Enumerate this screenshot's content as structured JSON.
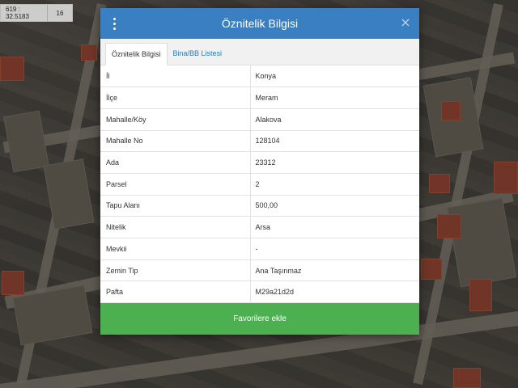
{
  "map": {
    "coordinate": "619 : 32.5183",
    "zoom": "16"
  },
  "dialog": {
    "title": "Öznitelik Bilgisi",
    "menu_icon": "kebab-menu-icon",
    "close_icon": "×",
    "tabs": [
      {
        "label": "Öznitelik Bilgisi",
        "active": true
      },
      {
        "label": "Bina/BB Listesi",
        "active": false
      }
    ],
    "rows": [
      {
        "key": "İl",
        "value": "Konya"
      },
      {
        "key": "İlçe",
        "value": "Meram"
      },
      {
        "key": "Mahalle/Köy",
        "value": "Alakova"
      },
      {
        "key": "Mahalle No",
        "value": "128104"
      },
      {
        "key": "Ada",
        "value": "23312"
      },
      {
        "key": "Parsel",
        "value": "2"
      },
      {
        "key": "Tapu Alanı",
        "value": "500,00"
      },
      {
        "key": "Nitelik",
        "value": "Arsa"
      },
      {
        "key": "Mevkii",
        "value": "-"
      },
      {
        "key": "Zemin Tip",
        "value": "Ana Taşınmaz"
      },
      {
        "key": "Pafta",
        "value": "M29a21d2d"
      }
    ],
    "favorite_label": "Favorilere ekle"
  },
  "colors": {
    "header": "#3a7fc2",
    "accent_link": "#2e78b9",
    "favorite_button": "#4caf50"
  }
}
